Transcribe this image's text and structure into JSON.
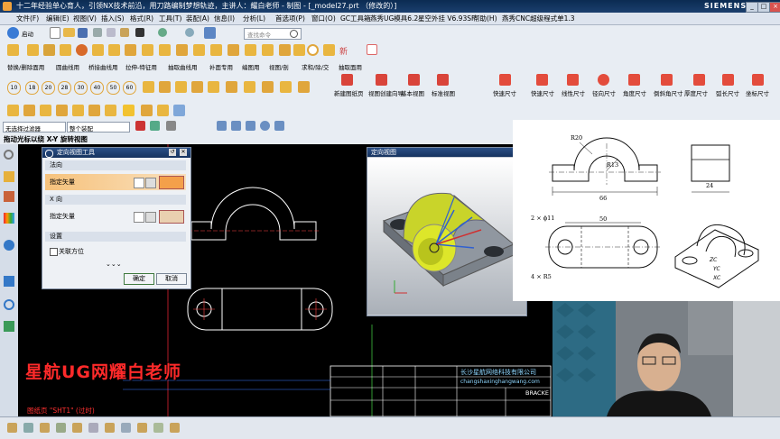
{
  "titlebar": {
    "title": "十二年经验单心育人，引领NX技术前沿，用刀路编制梦想轨迹，主讲人：耀白老师 - 制图 - [_model27.prt （修改的）]",
    "brand": "SIEMENS",
    "min": "_",
    "max": "□",
    "close": "×"
  },
  "menus": [
    "文件(F)",
    "编辑(E)",
    "视图(V)",
    "插入(S)",
    "格式(R)",
    "工具(T)",
    "装配(A)",
    "信息(I)",
    "分析(L)",
    "首选项(P)",
    "窗口(O)",
    "GC工具箱",
    "燕秀UG模具6.2",
    "星空外挂 V6.93SF",
    "帮助(H)",
    "燕秀CNC超级程式单1.3"
  ],
  "toolbar1": {
    "start": "启动",
    "search_placeholder": "查找命令"
  },
  "toolbar2": {
    "new": "新"
  },
  "toolbar3": {
    "items": [
      "替换/删除面用",
      "圆曲线用",
      "桥接曲线用",
      "拉伸-特征用",
      "抽取曲线用",
      "补面专用",
      "编图用",
      "视图/剖",
      "求和/除/交",
      "抽取面用"
    ]
  },
  "toolbar4": {
    "numbers": [
      "10",
      "18",
      "20",
      "28",
      "30",
      "40",
      "50",
      "60"
    ],
    "commands": [
      "新建图纸页",
      "视图创建向导",
      "基本视图",
      "标准视图",
      "快速尺寸",
      "快速尺寸",
      "线性尺寸",
      "径向尺寸",
      "角度尺寸",
      "倒斜角尺寸",
      "厚度尺寸",
      "弧长尺寸",
      "坐标尺寸"
    ]
  },
  "toolbar6": {
    "filter": "无选择过滤器",
    "assembly": "整个装配"
  },
  "hint": "拖动光标以绕 X-Y 旋转视图",
  "dialog": {
    "title": "定向视图工具",
    "sec1": "法向",
    "row1": "指定矢量",
    "sec2": "X 向",
    "row2": "指定矢量",
    "sec3": "设置",
    "checkbox": "关联方位",
    "ok": "确定",
    "cancel": "取消"
  },
  "view3d": {
    "title": "定向视图"
  },
  "reference": {
    "r20": "R20",
    "r13": "R13",
    "w66": "66",
    "w24": "24",
    "hole": "2 × ϕ11",
    "w50": "50",
    "r5": "4 × R5",
    "zc": "ZC",
    "yc": "YC",
    "xc": "XC"
  },
  "overlay": {
    "text": "星航UG网耀白老师"
  },
  "sheet": {
    "label": "图纸页 \"SHT1\" (过时)",
    "company": "长沙星航网络科技有限公司",
    "site": "changshaxinghangwang.com",
    "bracket": "BRACKE"
  },
  "colors": {
    "accent": "#f0a23c",
    "overlay_text": "#ff2a2a",
    "dialog_head": "#1f3f73"
  }
}
